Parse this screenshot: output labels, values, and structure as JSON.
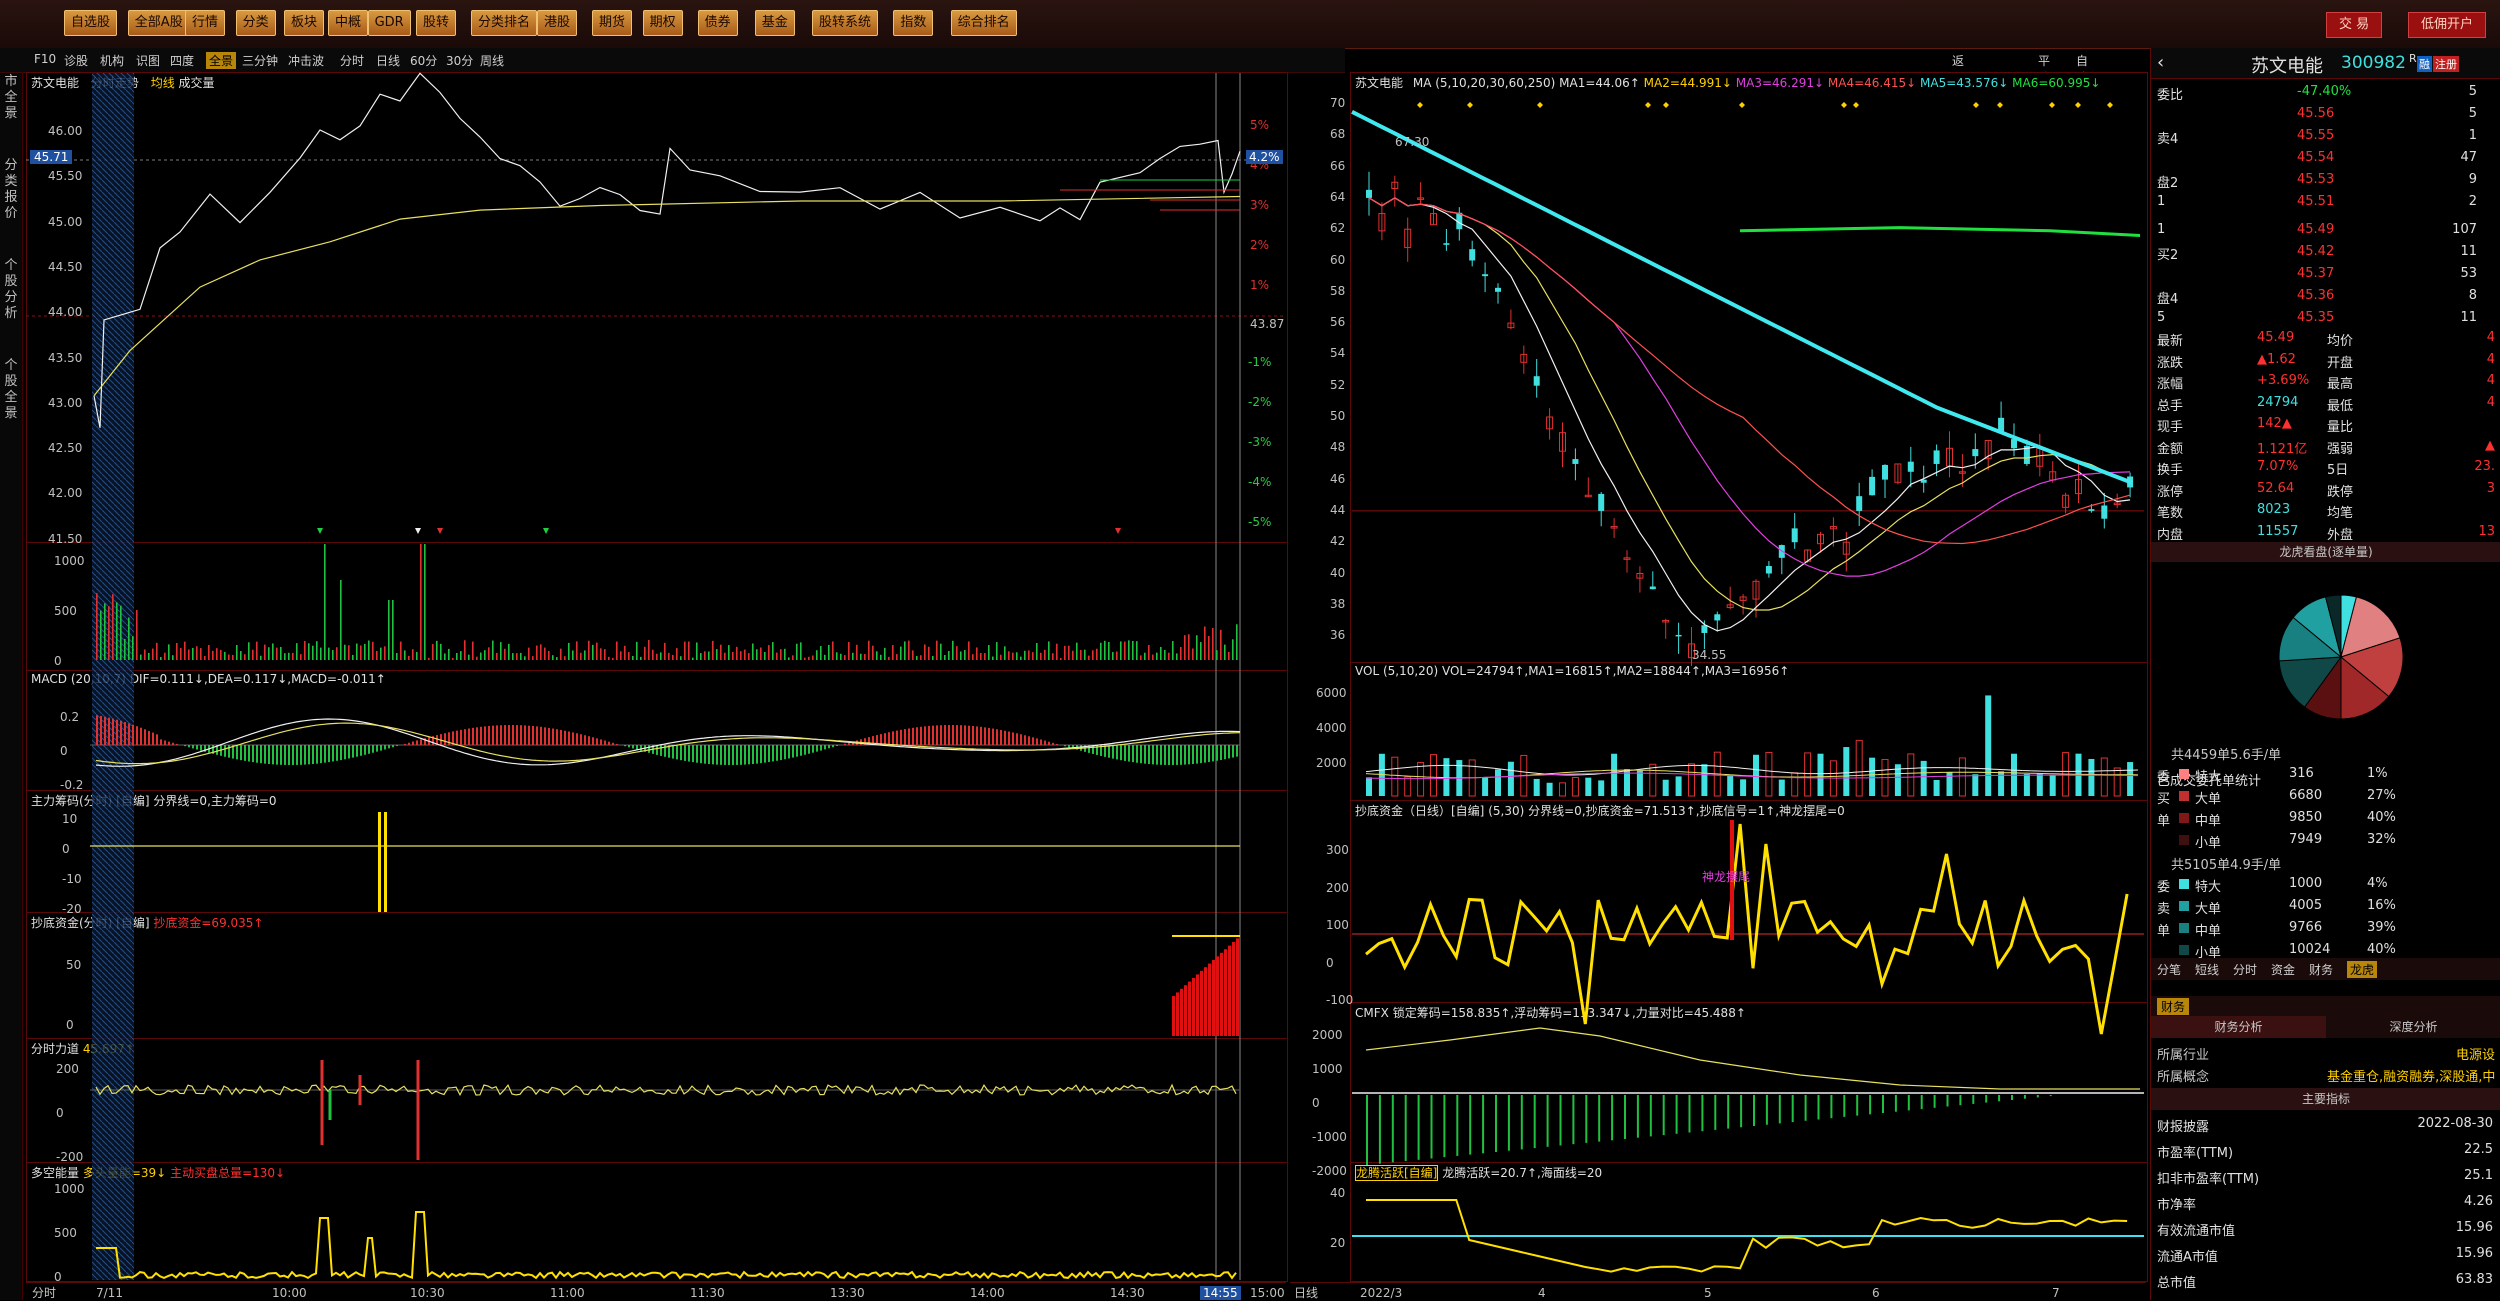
{
  "topbar": {
    "menu": [
      "自选股",
      "全部A股",
      "行情",
      "分类",
      "板块",
      "中概",
      "GDR",
      "股转",
      "分类排名",
      "港股",
      "期货",
      "期权",
      "债券",
      "基金",
      "股转系统",
      "指数",
      "综合排名"
    ],
    "trade": "交 易",
    "open_account": "低佣开户"
  },
  "toolrow": {
    "left": [
      "F10",
      "诊股",
      "机构",
      "识图",
      "四度",
      "全景",
      "三分钟",
      "冲击波",
      "分时",
      "日线",
      "60分",
      "30分",
      "周线"
    ],
    "right": [
      "返回个股分析",
      "平移",
      "自选"
    ]
  },
  "sidetabs": [
    "股市全景",
    "分类报价",
    "个股分析",
    "个股全景"
  ],
  "intraday": {
    "title": "苏文电能",
    "mode": "分时走势",
    "legend_avg": "均线",
    "legend_vol": "成交量",
    "price_ticks": [
      "46.00",
      "45.50",
      "45.00",
      "44.50",
      "44.00",
      "43.50",
      "43.00",
      "42.50",
      "42.00",
      "41.50"
    ],
    "current_price": "45.71",
    "pct_ticks_pos": [
      "5%",
      "4%",
      "3%",
      "2%",
      "1%"
    ],
    "pct_ticks_neg": [
      "-1%",
      "-2%",
      "-3%",
      "-4%",
      "-5%"
    ],
    "current_pct": "4.2%",
    "ref_price": "43.87",
    "vol_ticks": [
      "1000",
      "500",
      "0"
    ],
    "macd_title": "MACD",
    "macd_params": "(20,10,7)",
    "macd_values": "DIF=0.111↓,DEA=0.117↓,MACD=-0.011↑",
    "macd_ticks": [
      "0.2",
      "0",
      "-0.2"
    ],
    "main_chip_title": "主力筹码(分时) [自编]",
    "main_chip_values": "分界线=0,主力筹码=0",
    "main_chip_ticks": [
      "10",
      "0",
      "-10",
      "-20"
    ],
    "bottom_fund_title": "抄底资金(分时) [自编]",
    "bottom_fund_values": "抄底资金=69.035↑",
    "bottom_fund_ticks": [
      "50",
      "0"
    ],
    "force_title": "分时力道",
    "force_values": "45.697↑",
    "force_ticks": [
      "200",
      "0",
      "-200"
    ],
    "longshort_title": "多空能量",
    "longshort_values": "多头量能=39↓",
    "longshort_values2": "主动买盘总量=130↓",
    "longshort_ticks": [
      "1000",
      "500",
      "0"
    ],
    "time_labels": [
      "7/11",
      "10:00",
      "10:30",
      "11:00",
      "11:30",
      "13:30",
      "14:00",
      "14:30",
      "14:55",
      "15:00"
    ],
    "mode_btn": "分时"
  },
  "kline": {
    "title": "苏文电能",
    "ma_label": "MA",
    "ma_params": "(5,10,20,30,60,250)",
    "ma1": "MA1=44.06↑",
    "ma2": "MA2=44.991↓",
    "ma3": "MA3=46.291↓",
    "ma4": "MA4=46.415↓",
    "ma5": "MA5=43.576↓",
    "ma6": "MA6=60.995↓",
    "price_ticks": [
      "70",
      "68",
      "66",
      "64",
      "62",
      "60",
      "58",
      "56",
      "54",
      "52",
      "50",
      "48",
      "46",
      "44",
      "42",
      "40",
      "38",
      "36"
    ],
    "high_label": "67.30",
    "low_label": "34.55",
    "vol_title": "VOL",
    "vol_params": "(5,10,20)",
    "vol_values": "VOL=24794↑,MA1=16815↑,MA2=18844↑,MA3=16956↑",
    "vol_ticks": [
      "6000",
      "4000",
      "2000"
    ],
    "bottom_title": "抄底资金（日线）[自编]",
    "bottom_params": "(5,30)",
    "bottom_values": "分界线=0,抄底资金=71.513↑,抄底信号=1↑,神龙摆尾=0",
    "bottom_ticks": [
      "300",
      "200",
      "100",
      "0",
      "-100"
    ],
    "bottom_annotation": "神龙摆尾",
    "cmfx_title": "CMFX",
    "cmfx_values": "锁定筹码=158.835↑,浮动筹码=113.347↓,力量对比=45.488↑",
    "cmfx_ticks": [
      "2000",
      "1000",
      "0",
      "-1000",
      "-2000"
    ],
    "dragon_title": "龙腾活跃[自编]",
    "dragon_values": "龙腾活跃=20.7↑,海面线=20",
    "dragon_ticks": [
      "40",
      "20"
    ],
    "time_labels": [
      "2022/3",
      "4",
      "5",
      "6",
      "7"
    ],
    "mode_btn": "日线"
  },
  "quote": {
    "name": "苏文电能",
    "code": "300982",
    "badges": [
      "R",
      "融",
      "注册"
    ],
    "ratio_label": "委比",
    "ratio_value": "-47.40%",
    "ratio_count": "5",
    "asks": [
      {
        "label": "",
        "price": "45.56",
        "qty": "5"
      },
      {
        "label": "卖4",
        "price": "45.55",
        "qty": "1"
      },
      {
        "label": "",
        "price": "45.54",
        "qty": "47"
      },
      {
        "label": "盘2",
        "price": "45.53",
        "qty": "9"
      },
      {
        "label": "1",
        "price": "45.51",
        "qty": "2"
      }
    ],
    "bids": [
      {
        "label": "1",
        "price": "45.49",
        "qty": "107"
      },
      {
        "label": "买2",
        "price": "45.42",
        "qty": "11"
      },
      {
        "label": "",
        "price": "45.37",
        "qty": "53"
      },
      {
        "label": "盘4",
        "price": "45.36",
        "qty": "8"
      },
      {
        "label": "5",
        "price": "45.35",
        "qty": "11"
      }
    ],
    "stats": [
      {
        "l1": "最新",
        "v1": "45.49",
        "l2": "均价",
        "v2": "4"
      },
      {
        "l1": "涨跌",
        "v1": "▲1.62",
        "l2": "开盘",
        "v2": "4"
      },
      {
        "l1": "涨幅",
        "v1": "+3.69%",
        "l2": "最高",
        "v2": "4"
      },
      {
        "l1": "总手",
        "v1": "24794",
        "l2": "最低",
        "v2": "4"
      },
      {
        "l1": "现手",
        "v1": "142▲",
        "l2": "量比",
        "v2": ""
      },
      {
        "l1": "金额",
        "v1": "1.121亿",
        "l2": "强弱",
        "v2": "▲"
      },
      {
        "l1": "换手",
        "v1": "7.07%",
        "l2": "5日",
        "v2": "23."
      },
      {
        "l1": "涨停",
        "v1": "52.64",
        "l2": "跌停",
        "v2": "3"
      },
      {
        "l1": "笔数",
        "v1": "8023",
        "l2": "均笔",
        "v2": ""
      },
      {
        "l1": "内盘",
        "v1": "11557",
        "l2": "外盘",
        "v2": "13"
      }
    ],
    "pie_title": "龙虎看盘(逐单量)",
    "orders_title": "已成交委托单统计",
    "buy_summary": "共4459单5.6手/单",
    "buy_rows": [
      {
        "side": "委",
        "name": "特大",
        "qty": "316",
        "pct": "1%"
      },
      {
        "side": "买",
        "name": "大单",
        "qty": "6680",
        "pct": "27%"
      },
      {
        "side": "单",
        "name": "中单",
        "qty": "9850",
        "pct": "40%"
      },
      {
        "side": "",
        "name": "小单",
        "qty": "7949",
        "pct": "32%"
      }
    ],
    "sell_summary": "共5105单4.9手/单",
    "sell_rows": [
      {
        "side": "委",
        "name": "特大",
        "qty": "1000",
        "pct": "4%"
      },
      {
        "side": "卖",
        "name": "大单",
        "qty": "4005",
        "pct": "16%"
      },
      {
        "side": "单",
        "name": "中单",
        "qty": "9766",
        "pct": "39%"
      },
      {
        "side": "",
        "name": "小单",
        "qty": "10024",
        "pct": "40%"
      }
    ],
    "tabs": [
      "分笔",
      "短线",
      "分时",
      "资金",
      "财务",
      "龙虎"
    ],
    "fin_tab": "财务",
    "fin_sub": [
      "财务分析",
      "深度分析"
    ],
    "industry_label": "所属行业",
    "industry_value": "电源设",
    "concept_label": "所属概念",
    "concept_value": "基金重仓,融资融券,深股通,中",
    "indicators_title": "主要指标",
    "indicators": [
      {
        "label": "财报披露",
        "value": "2022-08-30"
      },
      {
        "label": "市盈率(TTM)",
        "value": "22.5"
      },
      {
        "label": "扣非市盈率(TTM)",
        "value": "25.1"
      },
      {
        "label": "市净率",
        "value": "4.26"
      },
      {
        "label": "有效流通市值",
        "value": "15.96"
      },
      {
        "label": "流通A市值",
        "value": "15.96"
      },
      {
        "label": "总市值",
        "value": "63.83"
      }
    ]
  }
}
